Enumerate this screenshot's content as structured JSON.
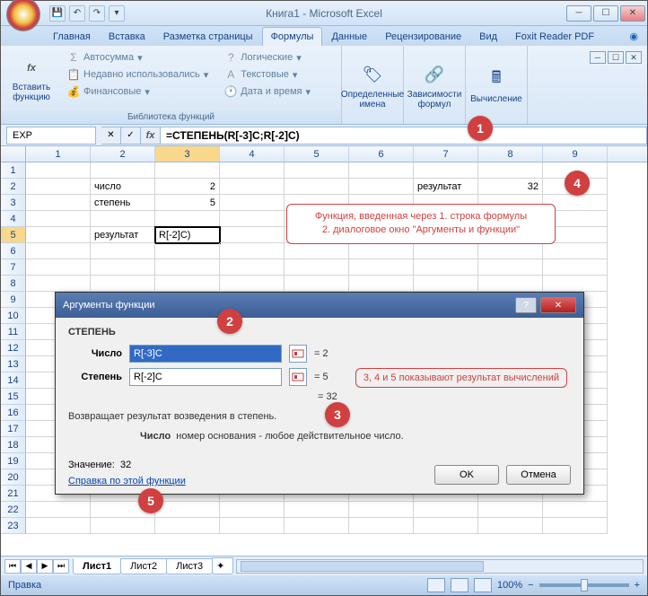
{
  "title": "Книга1 - Microsoft Excel",
  "tabs": [
    "Главная",
    "Вставка",
    "Разметка страницы",
    "Формулы",
    "Данные",
    "Рецензирование",
    "Вид",
    "Foxit Reader PDF"
  ],
  "activeTab": 3,
  "ribbon": {
    "insertFn": "Вставить функцию",
    "lib": "Библиотека функций",
    "items": [
      "Автосумма",
      "Недавно использовались",
      "Финансовые",
      "Логические",
      "Текстовые",
      "Дата и время"
    ],
    "definedNames": "Определенные имена",
    "formulaDeps": "Зависимости формул",
    "calc": "Вычисление"
  },
  "namebox": "EXP",
  "formula": "=СТЕПЕНЬ(R[-3]C;R[-2]C)",
  "colHeaders": [
    "1",
    "2",
    "3",
    "4",
    "5",
    "6",
    "7",
    "8",
    "9"
  ],
  "cells": {
    "r2c2": "число",
    "r2c3": "2",
    "r2c7": "результат",
    "r2c8": "32",
    "r3c2": "степень",
    "r3c3": "5",
    "r5c2": "результат",
    "r5c3": "R[-2]C)"
  },
  "callout1": {
    "line1": "Функция, введенная через 1. строка формулы",
    "line2": "2. диалоговое окно \"Аргументы и функции\""
  },
  "dialog": {
    "title": "Аргументы функции",
    "fname": "СТЕПЕНЬ",
    "arg1": {
      "label": "Число",
      "value": "R[-3]C",
      "result": "2"
    },
    "arg2": {
      "label": "Степень",
      "value": "R[-2]C",
      "result": "5"
    },
    "result": "32",
    "desc": "Возвращает результат возведения в степень.",
    "argdesc_label": "Число",
    "argdesc": "номер основания - любое действительное число.",
    "valueLabel": "Значение:",
    "value": "32",
    "help": "Справка по этой функции",
    "ok": "OK",
    "cancel": "Отмена",
    "callout": "3, 4 и 5 показывают результат вычислений"
  },
  "sheets": [
    "Лист1",
    "Лист2",
    "Лист3"
  ],
  "status": "Правка",
  "zoom": "100%"
}
